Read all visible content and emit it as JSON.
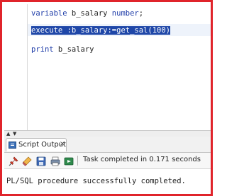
{
  "editor": {
    "line1": {
      "keyword": "variable",
      "name": " b_salary ",
      "type": "number",
      "end": ";"
    },
    "line2": {
      "keyword": "execute",
      "rest": " :b_salary:=get_sal(100)"
    },
    "line3": {
      "keyword": "print",
      "rest": " b_salary"
    }
  },
  "splitter": {
    "up_arrow": "▲",
    "down_arrow": "▼"
  },
  "output_panel": {
    "tab_label": "Script Output",
    "tab_close": "×",
    "toolbar": {
      "buttons": [
        "pin-icon",
        "eraser-icon",
        "save-icon",
        "print-icon",
        "open-icon"
      ],
      "status": "Task completed in 0.171 seconds"
    },
    "content": "PL/SQL procedure successfully completed."
  },
  "colors": {
    "frame_border": "#e0242b",
    "keyword": "#1e3ca8",
    "selection": "#1f47a8"
  }
}
